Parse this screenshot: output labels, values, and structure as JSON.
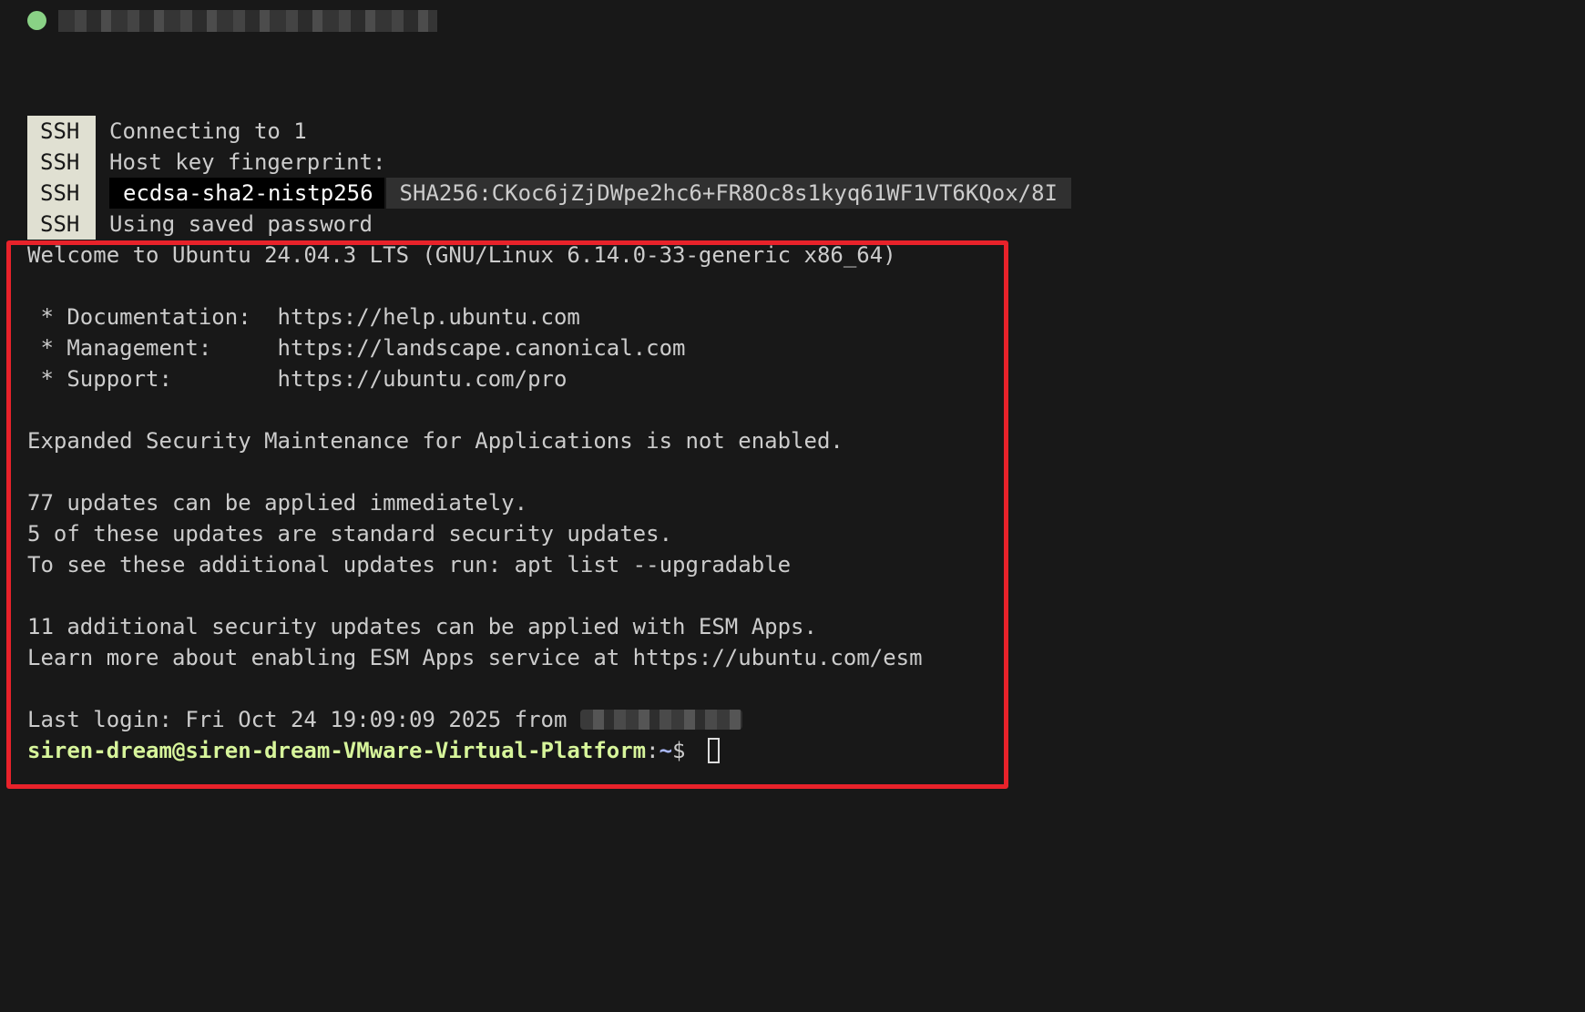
{
  "window": {
    "status_color": "#89d185"
  },
  "ssh": {
    "tag": "SSH",
    "lines": {
      "connecting": "Connecting to 1",
      "fingerprint_label": "Host key fingerprint:",
      "key_type": "ecdsa-sha2-nistp256",
      "key_hash": "SHA256:CKoc6jZjDWpe2hc6+FR8Oc8s1kyq61WF1VT6KQox/8I",
      "password": "Using saved password"
    }
  },
  "motd": {
    "welcome": "Welcome to Ubuntu 24.04.3 LTS (GNU/Linux 6.14.0-33-generic x86_64)",
    "docs": " * Documentation:  https://help.ubuntu.com",
    "management": " * Management:     https://landscape.canonical.com",
    "support": " * Support:        https://ubuntu.com/pro",
    "esm_status": "Expanded Security Maintenance for Applications is not enabled.",
    "updates_count": "77 updates can be applied immediately.",
    "security_updates": "5 of these updates are standard security updates.",
    "see_updates": "To see these additional updates run: apt list --upgradable",
    "esm_updates": "11 additional security updates can be applied with ESM Apps.",
    "esm_learn": "Learn more about enabling ESM Apps service at https://ubuntu.com/esm",
    "last_login": "Last login: Fri Oct 24 19:09:09 2025 from "
  },
  "prompt": {
    "user_host": "siren-dream@siren-dream-VMware-Virtual-Platform",
    "separator": ":",
    "path": "~",
    "symbol": "$ "
  },
  "annotation": {
    "box_color": "#e8222a"
  }
}
